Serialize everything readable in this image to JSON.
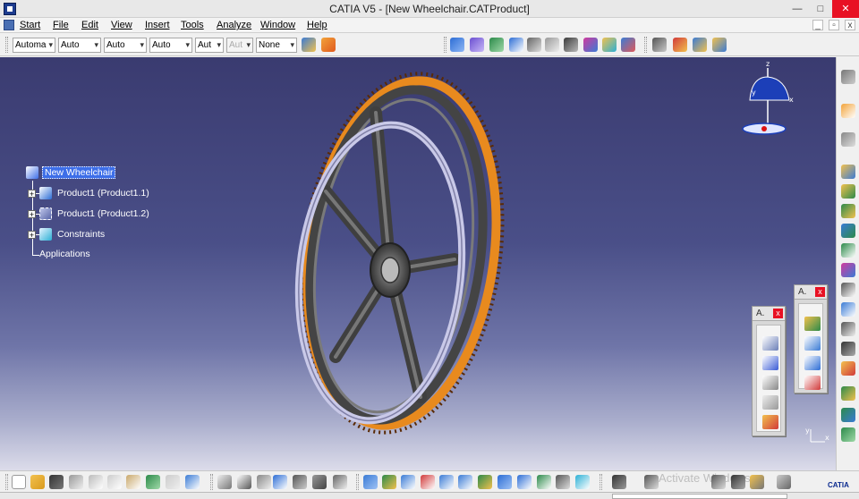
{
  "window": {
    "title": "CATIA V5 - [New Wheelchair.CATProduct]",
    "minimize": "—",
    "restore": "□",
    "close": "✕"
  },
  "menu": {
    "items": [
      "Start",
      "File",
      "Edit",
      "View",
      "Insert",
      "Tools",
      "Analyze",
      "Window",
      "Help"
    ],
    "mdi_minimize": "_",
    "mdi_restore": "▫",
    "mdi_close": "x"
  },
  "toolbar": {
    "combos": [
      "Automa",
      "Auto",
      "Auto",
      "Auto",
      "Aut",
      "Aut",
      "None"
    ]
  },
  "tree": {
    "root": "New Wheelchair",
    "children": [
      "Product1 (Product1.1)",
      "Product1 (Product1.2)",
      "Constraints"
    ],
    "applications": "Applications"
  },
  "compass": {
    "x_label": "x",
    "y_label": "y",
    "z_label": "z"
  },
  "palettes": {
    "left_title": "A.",
    "right_title": "A.",
    "close": "x"
  },
  "axis": {
    "x_label": "x",
    "y_label": "y"
  },
  "watermark": "Activate Windows",
  "brand": "CATIA",
  "colors": {
    "viewport_top": "#3a3b70",
    "viewport_bottom": "#dcdcea",
    "tire": "#e88a1e",
    "handrim": "#c9c9e8",
    "rim": "#555555",
    "selection": "#3d6ee8"
  },
  "icons": {
    "top_toolbar": [
      "fill-icon",
      "material-icon",
      "constraint-icon",
      "snap-icon",
      "measure-icon",
      "pencil-icon",
      "update-icon",
      "link-icon",
      "refresh-icon",
      "analysis-icon",
      "catalog-icon",
      "component-icon",
      "assembly-icon"
    ],
    "right_toolbar": [
      "gears-icon",
      "select-arrow-icon",
      "part-icon",
      "existing-component-icon",
      "replace-icon",
      "reorder-icon",
      "renumber-icon",
      "product-icon",
      "save-management-icon",
      "bill-of-material-icon",
      "update-product-icon",
      "load-icon",
      "snap-icon",
      "explode-icon",
      "fix-icon",
      "text-icon"
    ],
    "bottom_toolbar": [
      "new-icon",
      "open-icon",
      "save-icon",
      "print-icon",
      "cut-icon",
      "copy-icon",
      "paste-icon",
      "undo-icon",
      "redo-icon",
      "whats-this-icon",
      "formula-icon",
      "comment-icon",
      "knowledge-icon",
      "table-icon",
      "design-table-icon",
      "law-icon",
      "fly-icon",
      "fit-all-icon",
      "pan-icon",
      "rotate-icon",
      "zoom-in-icon",
      "zoom-out-icon",
      "normal-view-icon",
      "view-mode-icon",
      "iso-view-icon",
      "hide-show-icon",
      "swap-icon",
      "capture-icon",
      "plane-icon",
      "section-icon",
      "measure-icon",
      "clash-icon"
    ]
  }
}
